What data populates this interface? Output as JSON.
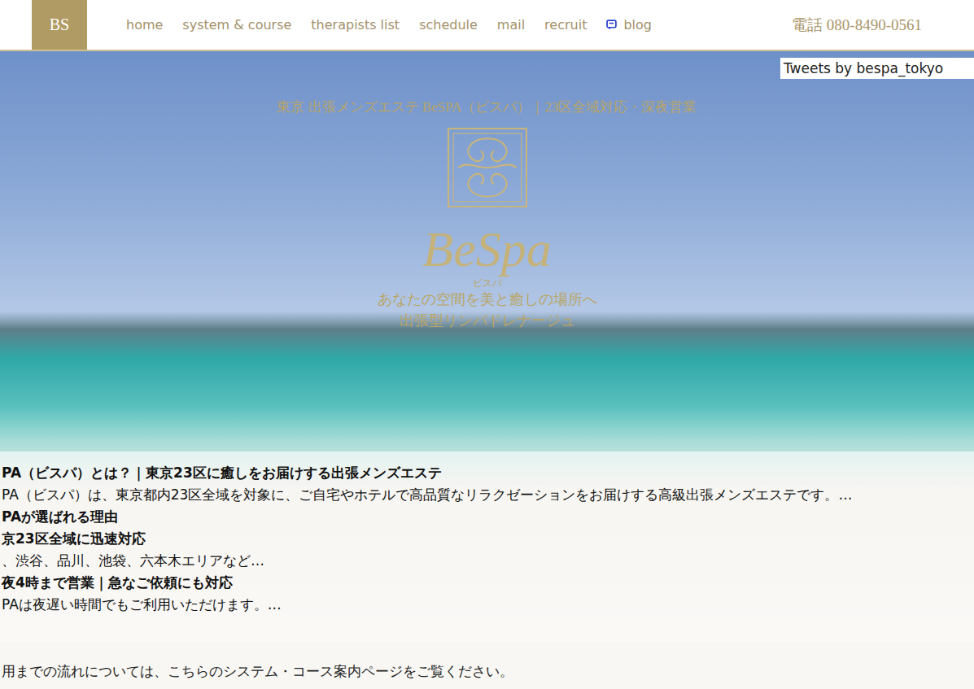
{
  "logo": "BS",
  "nav": [
    {
      "label": "home",
      "icon": false
    },
    {
      "label": "system & course",
      "icon": false
    },
    {
      "label": "therapists list",
      "icon": false
    },
    {
      "label": "schedule",
      "icon": false
    },
    {
      "label": "mail",
      "icon": false
    },
    {
      "label": "recruit",
      "icon": false
    },
    {
      "label": "blog",
      "icon": true
    }
  ],
  "phone": "電話 080-8490-0561",
  "twitter": "Tweets by bespa_tokyo",
  "hero": {
    "title": "東京 出張メンズエステ BeSPA（ビスパ）｜23区全域対応・深夜営業",
    "brand": "BeSpa",
    "brand_kana": "ビスパ",
    "tagline": [
      "あなたの空間を美と癒しの場所へ",
      "出張型リンパドレナージュ"
    ]
  },
  "intro": [
    {
      "kind": "heading",
      "text": "PA（ビスパ）とは？｜東京23区に癒しをお届けする出張メンズエステ"
    },
    {
      "kind": "body",
      "text": "PA（ビスパ）は、東京都内23区全域を対象に、ご自宅やホテルで高品質なリラクゼーションをお届けする高級出張メンズエステです。…"
    },
    {
      "kind": "heading",
      "text": "PAが選ばれる理由"
    },
    {
      "kind": "heading",
      "text": "京23区全域に迅速対応"
    },
    {
      "kind": "body",
      "text": "、渋谷、品川、池袋、六本木エリアなど…"
    },
    {
      "kind": "heading",
      "text": "夜4時まで営業｜急なご依頼にも対応"
    },
    {
      "kind": "body",
      "text": "PAは夜遅い時間でもご利用いただけます。…"
    }
  ],
  "footer_note": "用までの流れについては、こちらのシステム・コース案内ページをご覧ください。"
}
